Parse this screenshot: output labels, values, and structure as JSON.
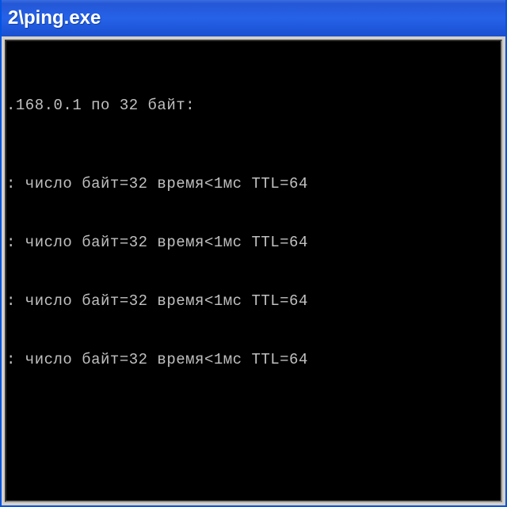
{
  "titlebar": {
    "text": "2\\ping.exe"
  },
  "console": {
    "header_line": ".168.0.1 по 32 байт:",
    "replies": [
      ": число байт=32 время<1мс TTL=64",
      ": число байт=32 время<1мс TTL=64",
      ": число байт=32 время<1мс TTL=64",
      ": число байт=32 время<1мс TTL=64"
    ]
  }
}
